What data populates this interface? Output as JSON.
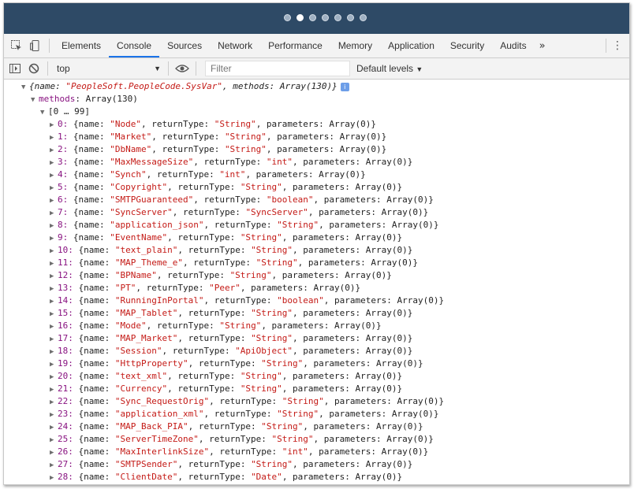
{
  "window": {
    "carousel_dots": 7,
    "active_dot": 1
  },
  "tabs": [
    "Elements",
    "Console",
    "Sources",
    "Network",
    "Performance",
    "Memory",
    "Application",
    "Security",
    "Audits"
  ],
  "active_tab": "Console",
  "toolbar": {
    "context": "top",
    "filter_placeholder": "Filter",
    "levels": "Default levels"
  },
  "colors": {
    "header_bg": "#2e4a66",
    "key": "#881280",
    "string": "#c41a16",
    "active_tab_underline": "#1a73e8"
  },
  "console": {
    "root": {
      "name_prefix": "{name: ",
      "name": "\"PeopleSoft.PeopleCode.SysVar\"",
      "rest": ", methods: Array(130)}"
    },
    "methods_key": "methods",
    "methods_val": ": Array(130)",
    "group_label": "[0 … 99]",
    "items": [
      {
        "name": "Node",
        "type": "String"
      },
      {
        "name": "Market",
        "type": "String"
      },
      {
        "name": "DbName",
        "type": "String"
      },
      {
        "name": "MaxMessageSize",
        "type": "int"
      },
      {
        "name": "Synch",
        "type": "int"
      },
      {
        "name": "Copyright",
        "type": "String"
      },
      {
        "name": "SMTPGuaranteed",
        "type": "boolean"
      },
      {
        "name": "SyncServer",
        "type": "SyncServer"
      },
      {
        "name": "application_json",
        "type": "String"
      },
      {
        "name": "EventName",
        "type": "String"
      },
      {
        "name": "text_plain",
        "type": "String"
      },
      {
        "name": "MAP_Theme_e",
        "type": "String"
      },
      {
        "name": "BPName",
        "type": "String"
      },
      {
        "name": "PT",
        "type": "Peer"
      },
      {
        "name": "RunningInPortal",
        "type": "boolean"
      },
      {
        "name": "MAP_Tablet",
        "type": "String"
      },
      {
        "name": "Mode",
        "type": "String"
      },
      {
        "name": "MAP_Market",
        "type": "String"
      },
      {
        "name": "Session",
        "type": "ApiObject"
      },
      {
        "name": "HttpProperty",
        "type": "String"
      },
      {
        "name": "text_xml",
        "type": "String"
      },
      {
        "name": "Currency",
        "type": "String"
      },
      {
        "name": "Sync_RequestOrig",
        "type": "String"
      },
      {
        "name": "application_xml",
        "type": "String"
      },
      {
        "name": "MAP_Back_PIA",
        "type": "String"
      },
      {
        "name": "ServerTimeZone",
        "type": "String"
      },
      {
        "name": "MaxInterlinkSize",
        "type": "int"
      },
      {
        "name": "SMTPSender",
        "type": "String"
      },
      {
        "name": "ClientDate",
        "type": "Date"
      }
    ]
  }
}
